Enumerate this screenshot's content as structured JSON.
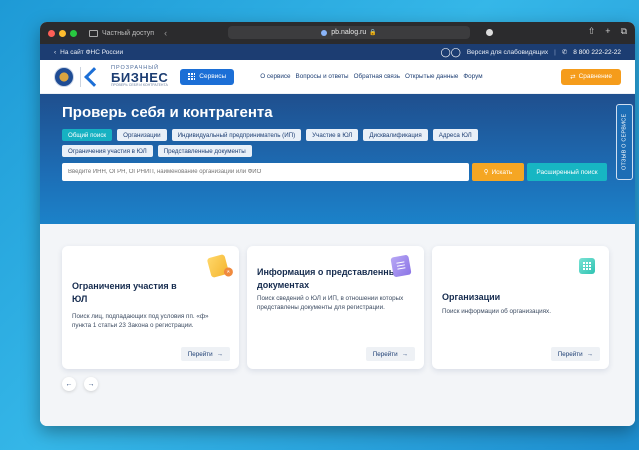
{
  "browser": {
    "private_label": "Частный доступ",
    "url": "pb.nalog.ru"
  },
  "topbar": {
    "back_link": "На сайт ФНС России",
    "accessibility": "Версия для слабовидящих",
    "phone": "8 800 222-22-22"
  },
  "header": {
    "logo_small": "ПРОЗРАЧНЫЙ",
    "logo_big": "БИЗНЕС",
    "logo_tiny": "ПРОВЕРЬ СЕБЯ И КОНТРАГЕНТА",
    "services_label": "Сервисы",
    "nav": [
      "О сервисе",
      "Вопросы и ответы",
      "Обратная связь",
      "Открытые данные",
      "Форум"
    ],
    "compare_label": "Сравнение"
  },
  "hero": {
    "title": "Проверь себя и контрагента",
    "chips": [
      "Общий поиск",
      "Организации",
      "Индивидуальный предприниматель (ИП)",
      "Участие в ЮЛ",
      "Дисквалификация",
      "Адреса ЮЛ",
      "Ограничения участия в ЮЛ",
      "Представленные документы"
    ],
    "search_placeholder": "Введите ИНН, ОГРН, ОГРНИП, наименование организации или ФИО",
    "search_button": "Искать",
    "advanced_button": "Расширенный поиск",
    "feedback_tab": "ОТЗЫВ О СЕРВИСЕ"
  },
  "cards": [
    {
      "title": "Ограничения участия в ЮЛ",
      "description": "Поиск лиц, подпадающих под условия пп. «ф» пункта 1 статьи 23 Закона о регистрации.",
      "button": "Перейти"
    },
    {
      "title": "Информация о представленных документах",
      "description": "Поиск сведений о ЮЛ и ИП, в отношении которых представлены документы для регистрации.",
      "button": "Перейти"
    },
    {
      "title": "Организации",
      "description": "Поиск информации об организациях.",
      "button": "Перейти"
    }
  ],
  "colors": {
    "primary": "#1c6fd6",
    "dark_navy": "#1c3d72",
    "accent_orange": "#f5a623",
    "accent_teal": "#17b6c3"
  }
}
